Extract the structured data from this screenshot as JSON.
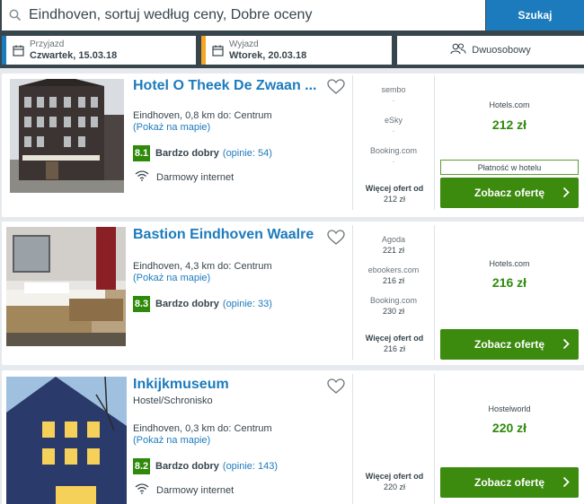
{
  "search": {
    "query": "Eindhoven, sortuj według ceny, Dobre oceny",
    "button_label": "Szukaj"
  },
  "dates": {
    "checkin_label": "Przyjazd",
    "checkin_value": "Czwartek, 15.03.18",
    "checkout_label": "Wyjazd",
    "checkout_value": "Wtorek, 20.03.18"
  },
  "room": {
    "label": "Dwuosobowy"
  },
  "colors": {
    "brand_blue": "#1c7bbd",
    "cta_green": "#3c8a0e",
    "rating_green": "#2f8a0b",
    "checkin_strip": "#1c7bbd",
    "checkout_strip": "#f5a623"
  },
  "hotels": [
    {
      "name": "Hotel O Theek De Zwaan ...",
      "location": "Eindhoven, 0,8 km do: Centrum",
      "map_link": "(Pokaż na mapie)",
      "score": "8.1",
      "rating_word": "Bardzo dobry",
      "reviews": "(opinie: 54)",
      "amenity": "Darmowy internet",
      "deals": [
        {
          "name": "sembo",
          "price": "-"
        },
        {
          "name": "eSky",
          "price": "-"
        },
        {
          "name": "Booking.com",
          "price": "-"
        }
      ],
      "more_label": "Więcej ofert od",
      "more_price": "212 zł",
      "best_provider": "Hotels.com",
      "best_price": "212 zł",
      "pay_badge": "Płatność w hotelu",
      "cta": "Zobacz ofertę"
    },
    {
      "name": "Bastion Eindhoven Waalre",
      "location": "Eindhoven, 4,3 km do: Centrum",
      "map_link": "(Pokaż na mapie)",
      "score": "8.3",
      "rating_word": "Bardzo dobry",
      "reviews": "(opinie: 33)",
      "deals": [
        {
          "name": "Agoda",
          "price": "221 zł"
        },
        {
          "name": "ebookers.com",
          "price": "216 zł"
        },
        {
          "name": "Booking.com",
          "price": "230 zł"
        }
      ],
      "more_label": "Więcej ofert od",
      "more_price": "216 zł",
      "best_provider": "Hotels.com",
      "best_price": "216 zł",
      "cta": "Zobacz ofertę"
    },
    {
      "name": "Inkijkmuseum",
      "type": "Hostel/Schronisko",
      "location": "Eindhoven, 0,3 km do: Centrum",
      "map_link": "(Pokaż na mapie)",
      "score": "8.2",
      "rating_word": "Bardzo dobry",
      "reviews": "(opinie: 143)",
      "amenity": "Darmowy internet",
      "more_label": "Więcej ofert od",
      "more_price": "220 zł",
      "best_provider": "Hostelworld",
      "best_price": "220 zł",
      "cta": "Zobacz ofertę"
    }
  ]
}
